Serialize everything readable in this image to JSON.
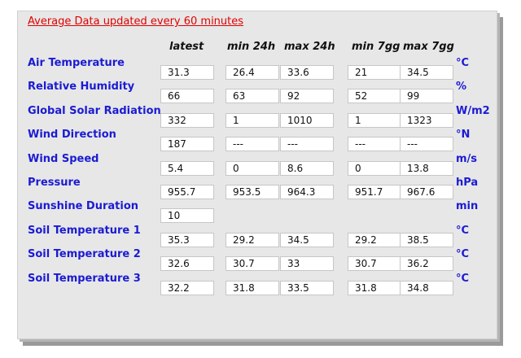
{
  "title": "Average Data updated every 60 minutes",
  "headers": [
    "latest",
    "min 24h",
    "max 24h",
    "min 7gg",
    "max 7gg"
  ],
  "rows": [
    {
      "label": "Air Temperature",
      "unit": "°C",
      "values": [
        "31.3",
        "26.4",
        "33.6",
        "21",
        "34.5"
      ]
    },
    {
      "label": "Relative Humidity",
      "unit": "%",
      "values": [
        "66",
        "63",
        "92",
        "52",
        "99"
      ]
    },
    {
      "label": "Global Solar Radiation",
      "unit": "W/m2",
      "values": [
        "332",
        "1",
        "1010",
        "1",
        "1323"
      ]
    },
    {
      "label": "Wind Direction",
      "unit": "°N",
      "values": [
        "187",
        "---",
        "---",
        "---",
        "---"
      ]
    },
    {
      "label": "Wind Speed",
      "unit": "m/s",
      "values": [
        "5.4",
        "0",
        "8.6",
        "0",
        "13.8"
      ]
    },
    {
      "label": "Pressure",
      "unit": "hPa",
      "values": [
        "955.7",
        "953.5",
        "964.3",
        "951.7",
        "967.6"
      ]
    },
    {
      "label": "Sunshine Duration",
      "unit": "min",
      "values": [
        "10"
      ]
    },
    {
      "label": "Soil Temperature 1",
      "unit": "°C",
      "values": [
        "35.3",
        "29.2",
        "34.5",
        "29.2",
        "38.5"
      ]
    },
    {
      "label": "Soil Temperature 2",
      "unit": "°C",
      "values": [
        "32.6",
        "30.7",
        "33",
        "30.7",
        "36.2"
      ]
    },
    {
      "label": "Soil Temperature 3",
      "unit": "°C",
      "values": [
        "32.2",
        "31.8",
        "33.5",
        "31.8",
        "34.8"
      ]
    }
  ],
  "colors": {
    "title": "#e10000",
    "labels": "#1b1bd3",
    "panel": "#e7e7e7"
  }
}
